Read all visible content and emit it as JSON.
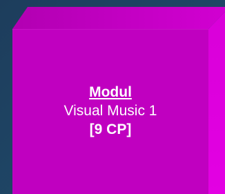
{
  "colors": {
    "background": "#1f4666",
    "cube_front": "#c000c0",
    "cube_top": "#b800b8",
    "cube_side": "#e000e0",
    "text": "#ffffff"
  },
  "module_box": {
    "title": "Modul",
    "name": "Visual Music 1",
    "credits": "[9 CP]"
  }
}
